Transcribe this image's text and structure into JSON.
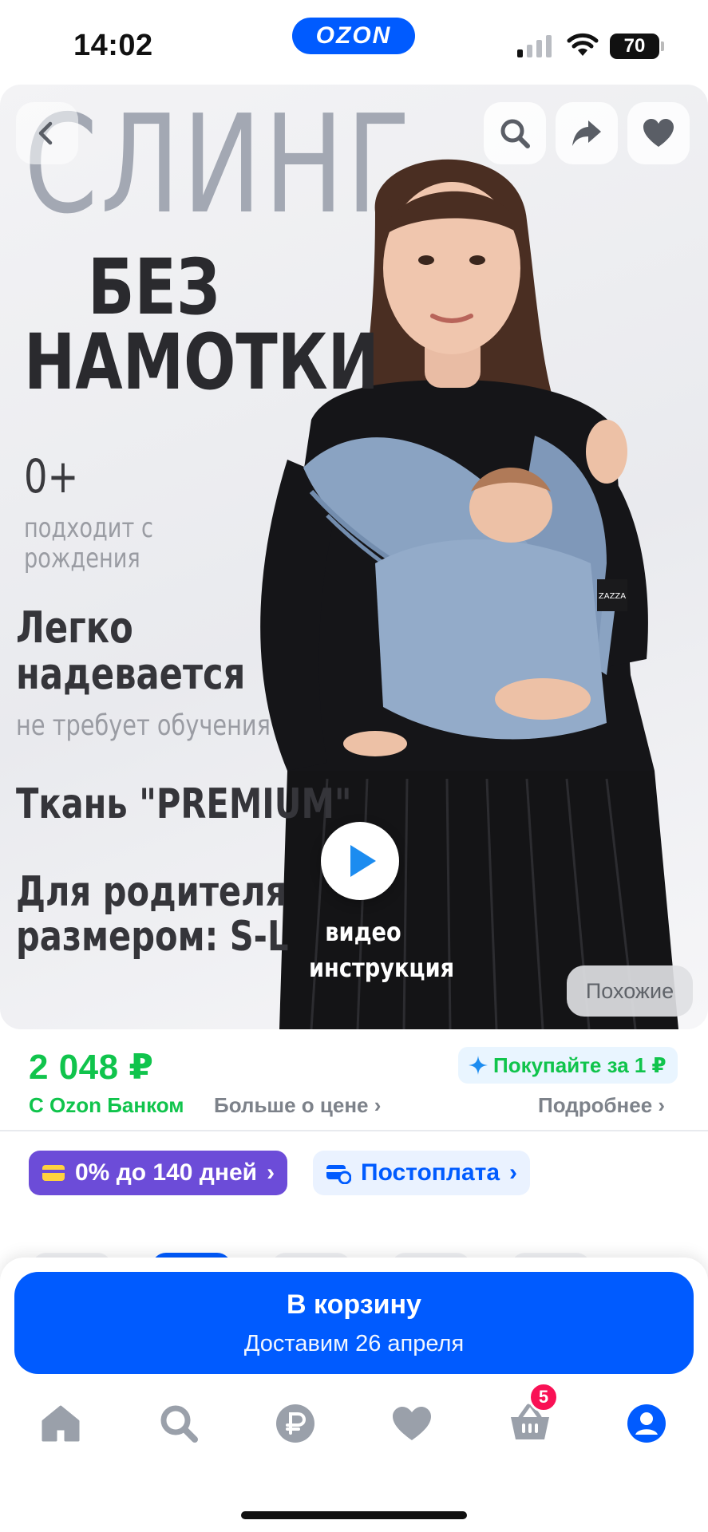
{
  "status_bar": {
    "time": "14:02",
    "brand": "OZON",
    "battery": "70",
    "icons": [
      "signal-icon",
      "wifi-icon",
      "battery-icon"
    ]
  },
  "hero": {
    "banner_title": "СЛИНГ",
    "banner_line_1": "БЕЗ",
    "banner_line_2": "НАМОТКИ",
    "age": "0+",
    "age_note_1": "подходит с",
    "age_note_2": "рождения",
    "feature_1_a": "Легко",
    "feature_1_b": "надевается",
    "feature_1_note": "не требует обучения",
    "feature_2": "Ткань \"PREMIUM\"",
    "feature_3_a": "Для родителя",
    "feature_3_b": "размером: S-L",
    "product_tag": "ZAZZA",
    "video_label_1": "видео",
    "video_label_2": "инструкция",
    "similar_button": "Похожие",
    "icons": [
      "back-icon",
      "search-icon",
      "share-icon",
      "heart-icon",
      "play-icon"
    ]
  },
  "price": {
    "amount": "2 048 ₽",
    "bank_label": "С Ozon Банком",
    "more_price_link": "Больше о цене",
    "promo": "Покупайте за 1 ₽",
    "details_link": "Подробнее"
  },
  "payment": {
    "installment": "0% до 140 дней",
    "postpay": "Постоплата"
  },
  "cart_button": {
    "label": "В корзину",
    "delivery": "Доставим 26 апреля"
  },
  "tabbar": {
    "items": [
      "home-icon",
      "search-icon",
      "ruble-icon",
      "favorites-icon",
      "cart-icon",
      "profile-icon"
    ],
    "cart_badge": "5"
  },
  "colors": {
    "brand_blue": "#005bff",
    "price_green": "#10c44c",
    "installment_purple": "#6c4cd8",
    "badge_pink": "#f91155"
  }
}
